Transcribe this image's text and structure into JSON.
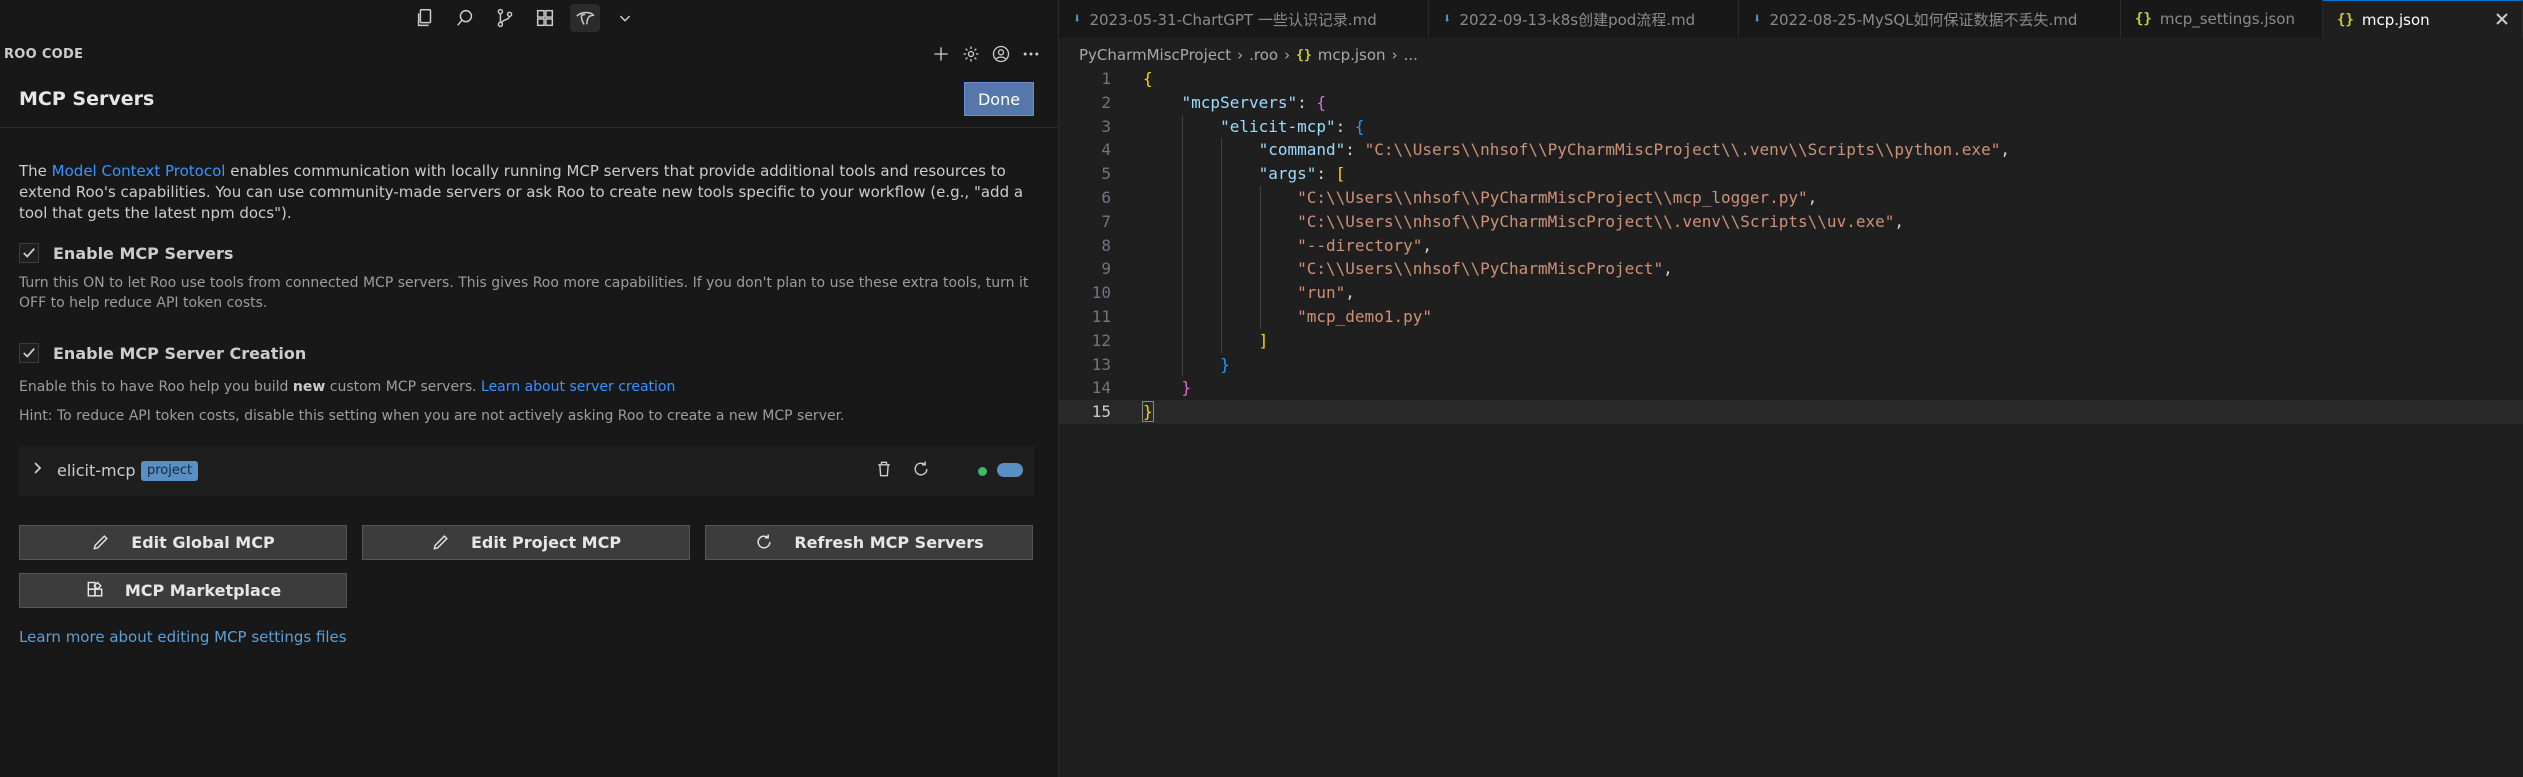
{
  "sidebar": {
    "title": "ROO CODE",
    "activity_icons": [
      "explorer-icon",
      "search-icon",
      "source-control-icon",
      "extensions-icon",
      "roo-icon",
      "chevron-down-icon"
    ],
    "header_icons": [
      "plus-icon",
      "gear-icon",
      "account-icon",
      "more-icon"
    ]
  },
  "mcp": {
    "title": "MCP Servers",
    "done_label": "Done",
    "intro_prefix": "The ",
    "intro_link": "Model Context Protocol",
    "intro_suffix": " enables communication with locally running MCP servers that provide additional tools and resources to extend Roo's capabilities. You can use community-made servers or ask Roo to create new tools specific to your workflow (e.g., \"add a tool that gets the latest npm docs\").",
    "enable_servers": {
      "label": "Enable MCP Servers",
      "checked": true,
      "description": "Turn this ON to let Roo use tools from connected MCP servers. This gives Roo more capabilities. If you don't plan to use these extra tools, turn it OFF to help reduce API token costs."
    },
    "enable_creation": {
      "label": "Enable MCP Server Creation",
      "checked": true,
      "desc_prefix": "Enable this to have Roo help you build ",
      "desc_bold": "new",
      "desc_middle": " custom MCP servers. ",
      "desc_link": "Learn about server creation",
      "hint": "Hint: To reduce API token costs, disable this setting when you are not actively asking Roo to create a new MCP server."
    },
    "server": {
      "name": "elicit-mcp",
      "badge": "project",
      "status_color": "#3cba6a",
      "enabled": true
    },
    "buttons": {
      "edit_global": "Edit Global MCP",
      "edit_project": "Edit Project MCP",
      "refresh": "Refresh MCP Servers",
      "marketplace": "MCP Marketplace"
    },
    "learn_more": "Learn more about editing MCP settings files"
  },
  "editor": {
    "tabs": [
      {
        "label": "2023-05-31-ChartGPT 一些认识记录.md",
        "type": "md"
      },
      {
        "label": "2022-09-13-k8s创建pod流程.md",
        "type": "md"
      },
      {
        "label": "2022-08-25-MySQL如何保证数据不丢失.md",
        "type": "md"
      },
      {
        "label": "mcp_settings.json",
        "type": "json"
      },
      {
        "label": "mcp.json",
        "type": "json",
        "active": true
      }
    ],
    "json_icon_glyph": "{}",
    "breadcrumb": {
      "project": "PyCharmMiscProject",
      "folder": ".roo",
      "file": "mcp.json",
      "ellipsis": "..."
    },
    "line_numbers": [
      "1",
      "2",
      "3",
      "4",
      "5",
      "6",
      "7",
      "8",
      "9",
      "10",
      "11",
      "12",
      "13",
      "14",
      "15"
    ],
    "current_line": 15,
    "code": {
      "key_servers": "\"mcpServers\"",
      "key_server": "\"elicit-mcp\"",
      "key_command": "\"command\"",
      "val_command": "\"C:\\\\Users\\\\nhsof\\\\PyCharmMiscProject\\\\.venv\\\\Scripts\\\\python.exe\"",
      "key_args": "\"args\"",
      "args": [
        "\"C:\\\\Users\\\\nhsof\\\\PyCharmMiscProject\\\\mcp_logger.py\"",
        "\"C:\\\\Users\\\\nhsof\\\\PyCharmMiscProject\\\\.venv\\\\Scripts\\\\uv.exe\"",
        "\"--directory\"",
        "\"C:\\\\Users\\\\nhsof\\\\PyCharmMiscProject\"",
        "\"run\"",
        "\"mcp_demo1.py\""
      ]
    },
    "colors": {
      "key": "#9cdcfe",
      "string": "#ce9178",
      "bracket_gold": "#ffd700",
      "bracket_purple": "#da70d6",
      "bracket_blue": "#179fff"
    }
  }
}
